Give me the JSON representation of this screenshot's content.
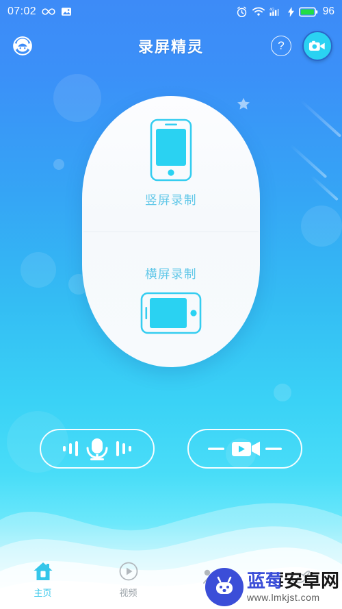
{
  "statusbar": {
    "time": "07:02",
    "battery_percent": "96",
    "icons": [
      "infinity-icon",
      "image-icon",
      "alarm-icon",
      "wifi-icon",
      "signal-4g-icon",
      "charging-bolt-icon",
      "battery-icon"
    ],
    "signal_label": "4G"
  },
  "header": {
    "title": "录屏精灵",
    "avatar_icon": "headset-face-icon",
    "help_label": "?",
    "record_icon": "video-camera-icon"
  },
  "card": {
    "portrait": {
      "label": "竖屏录制",
      "icon": "phone-portrait-icon"
    },
    "landscape": {
      "label": "横屏录制",
      "icon": "phone-landscape-icon"
    }
  },
  "actions": [
    {
      "name": "audio-record-button",
      "icon": "microphone-icon"
    },
    {
      "name": "video-record-button",
      "icon": "video-camera-icon"
    }
  ],
  "bottom_nav": [
    {
      "label": "主页",
      "icon": "home-icon",
      "active": true
    },
    {
      "label": "视频",
      "icon": "play-circle-icon",
      "active": false
    },
    {
      "label": "",
      "icon": "image-mountain-icon",
      "active": false
    },
    {
      "label": "",
      "icon": "settings-orbit-icon",
      "active": false
    }
  ],
  "watermark": {
    "name_cn": "蓝莓安卓网",
    "url": "www.lmkjst.com",
    "logo_icon": "android-robot-icon"
  },
  "colors": {
    "bg_top": "#3d8bf7",
    "bg_bottom": "#6ce8fb",
    "accent_cyan": "#2ad2f2",
    "card_label": "#62c8e8",
    "nav_active": "#34c6ea",
    "nav_inactive": "#9aa2a8",
    "watermark_blue": "#3b4ed8"
  }
}
